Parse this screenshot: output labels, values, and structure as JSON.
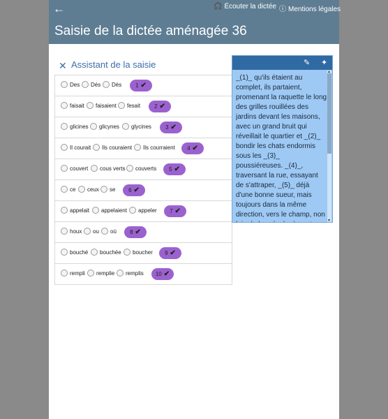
{
  "header": {
    "back_icon": "arrow-left-icon",
    "listen_label": "Écouter la dictée",
    "legal_label": "Mentions légales",
    "title": "Saisie de la dictée aménagée 36"
  },
  "assistant": {
    "title": "Assistant de la saisie",
    "close_icon": "close-icon"
  },
  "rows": [
    {
      "options": [
        "Des",
        "Dés",
        "Dès"
      ],
      "number": "1"
    },
    {
      "options": [
        "faisait",
        "faisaient",
        "fesait"
      ],
      "number": "2"
    },
    {
      "options": [
        "glicines",
        "glicynes",
        "glycines"
      ],
      "number": "3"
    },
    {
      "options": [
        "Il courait",
        "Ils couraient",
        "Ils courraient"
      ],
      "number": "4"
    },
    {
      "options": [
        "couvert",
        "cous verts",
        "couverts"
      ],
      "number": "5"
    },
    {
      "options": [
        "ce",
        "ceux",
        "se"
      ],
      "number": "6"
    },
    {
      "options": [
        "appelait",
        "appelaient",
        "appeler"
      ],
      "number": "7"
    },
    {
      "options": [
        "houx",
        "ou",
        "où"
      ],
      "number": "8"
    },
    {
      "options": [
        "bouché",
        "bouchée",
        "boucher"
      ],
      "number": "9"
    },
    {
      "options": [
        "rempli",
        "remplie",
        "remplis"
      ],
      "number": "10"
    }
  ],
  "panel": {
    "text": "_(1)_ qu'ils étaient au complet, ils partaient, promenant la raquette le long des grilles rouillées des jardins devant les maisons, avec un grand bruit qui réveillait le quartier et _(2)_ bondir les chats endormis sous les _(3)_ poussiéreuses. _(4)_, traversant la rue, essayant de s'attraper, _(5)_ déjà d'une bonne sueur, mais toujours dans la même direction, vers le champ, non loin de leur école, à quatre ou cinq rues de là."
  }
}
